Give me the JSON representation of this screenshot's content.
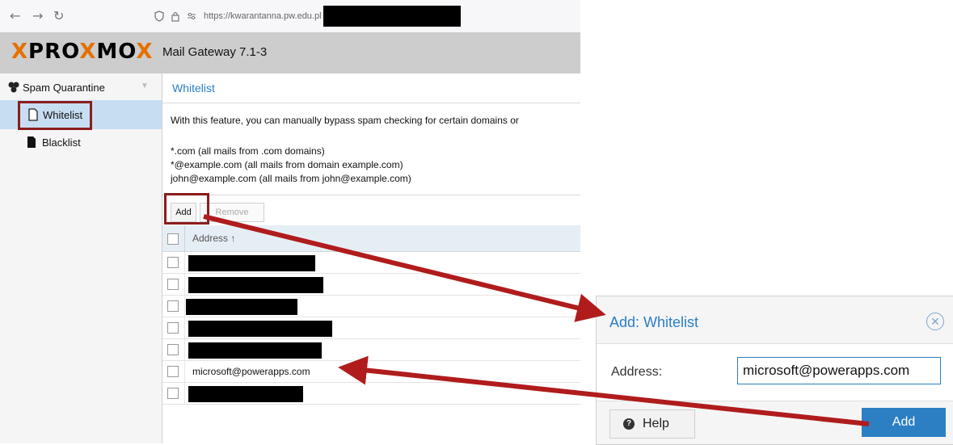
{
  "browser": {
    "url": "https://kwarantanna.pw.edu.pl"
  },
  "header": {
    "logo_part1": "X",
    "logo_part2": "PRO",
    "logo_part3": "X",
    "logo_part4": "MO",
    "logo_part5": "X",
    "product": "Mail Gateway 7.1-3"
  },
  "sidebar": {
    "root": "Spam Quarantine",
    "items": [
      {
        "label": "Whitelist"
      },
      {
        "label": "Blacklist"
      }
    ]
  },
  "panel": {
    "title": "Whitelist",
    "description": "With this feature, you can manually bypass spam checking for certain domains or",
    "examples": [
      "*.com (all mails from .com domains)",
      "*@example.com (all mails from domain example.com)",
      "john@example.com (all mails from john@example.com)"
    ],
    "add_label": "Add",
    "remove_label": "Remove",
    "column_address": "Address ↑",
    "visible_row": "microsoft@powerapps.com"
  },
  "dialog": {
    "title": "Add: Whitelist",
    "close_glyph": "✕",
    "address_label": "Address:",
    "address_value": "microsoft@powerapps.com",
    "help_label": "Help",
    "add_label": "Add"
  },
  "colors": {
    "accent": "#2a7fc5",
    "highlight": "#8b1d1d",
    "logo_orange": "#e57000"
  }
}
